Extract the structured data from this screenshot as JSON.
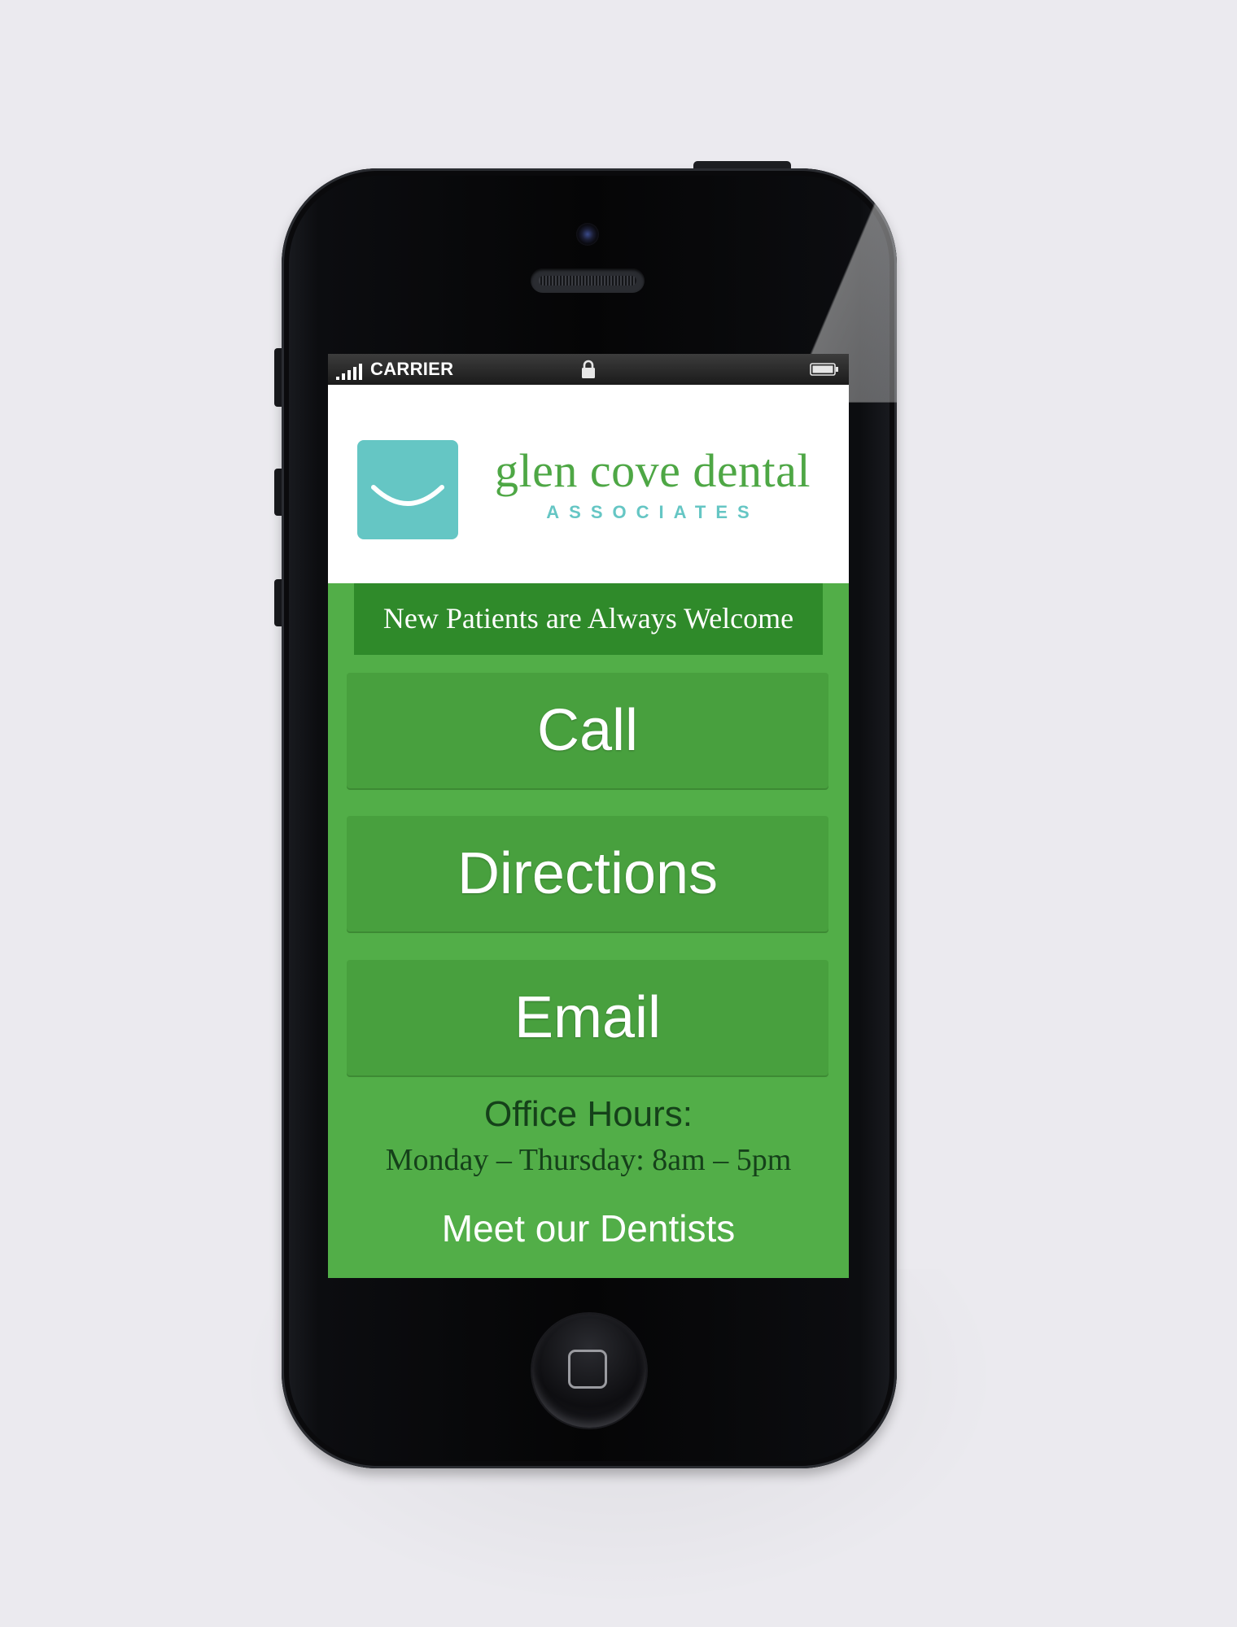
{
  "status_bar": {
    "carrier": "CARRIER",
    "signal_icon": "signal-bars-icon",
    "lock_icon": "lock-icon",
    "battery_icon": "battery-icon"
  },
  "header": {
    "logo_icon": "smile-logo-icon",
    "brand_name": "glen cove dental",
    "brand_subtitle": "ASSOCIATES"
  },
  "banner": {
    "text": "New Patients are Always Welcome"
  },
  "actions": {
    "call_label": "Call",
    "directions_label": "Directions",
    "email_label": "Email"
  },
  "office_hours": {
    "title": "Office Hours:",
    "schedule": "Monday – Thursday: 8am – 5pm"
  },
  "links": {
    "meet_dentists": "Meet our Dentists"
  },
  "colors": {
    "brand_green": "#52ae48",
    "banner_green": "#2f8a2a",
    "button_green": "#48a03e",
    "logo_teal": "#65c6c4",
    "text_dark_green": "#15411a"
  }
}
